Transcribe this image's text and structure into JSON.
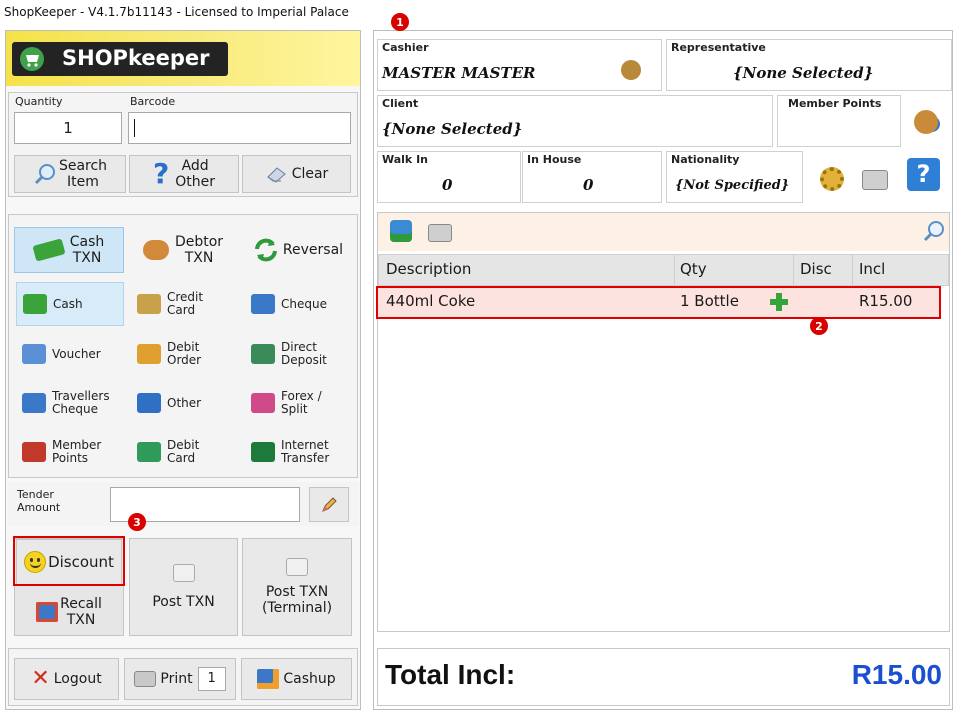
{
  "window": {
    "title": "ShopKeeper - V4.1.7b11143 - Licensed to Imperial Palace"
  },
  "logo": {
    "text": "SHOPkeeper"
  },
  "entry": {
    "quantity_label": "Quantity",
    "quantity_value": "1",
    "barcode_label": "Barcode",
    "barcode_value": ""
  },
  "actions": {
    "search": [
      "Search",
      "Item"
    ],
    "add": [
      "Add",
      "Other"
    ],
    "clear": "Clear"
  },
  "txn_types": {
    "cash": [
      "Cash",
      "TXN"
    ],
    "debtor": [
      "Debtor",
      "TXN"
    ],
    "reversal": "Reversal"
  },
  "payment_methods": [
    {
      "label": "Cash",
      "icon": "cash-icon",
      "color": "#3aa43a"
    },
    {
      "label": "Credit\nCard",
      "icon": "credit-card-icon",
      "color": "#c8a24a"
    },
    {
      "label": "Cheque",
      "icon": "cheque-icon",
      "color": "#3b78c8"
    },
    {
      "label": "Voucher",
      "icon": "voucher-icon",
      "color": "#5b8fd6"
    },
    {
      "label": "Debit\nOrder",
      "icon": "debit-order-icon",
      "color": "#e0a030"
    },
    {
      "label": "Direct\nDeposit",
      "icon": "direct-deposit-icon",
      "color": "#3a8a5a"
    },
    {
      "label": "Travellers\nCheque",
      "icon": "travellers-cheque-icon",
      "color": "#3b78c8"
    },
    {
      "label": "Other",
      "icon": "other-help-icon",
      "color": "#2f6fc4"
    },
    {
      "label": "Forex /\nSplit",
      "icon": "forex-icon",
      "color": "#d04a8a"
    },
    {
      "label": "Member\nPoints",
      "icon": "member-points-icon",
      "color": "#c0392b"
    },
    {
      "label": "Debit\nCard",
      "icon": "debit-card-icon",
      "color": "#2f9a5a"
    },
    {
      "label": "Internet\nTransfer",
      "icon": "globe-icon",
      "color": "#1e7a3a"
    }
  ],
  "tender": {
    "label": "Tender\nAmount",
    "value": ""
  },
  "bottom_actions": {
    "discount": "Discount",
    "recall": [
      "Recall",
      "TXN"
    ],
    "post": "Post TXN",
    "post_terminal": [
      "Post TXN",
      "(Terminal)"
    ]
  },
  "footer": {
    "logout": "Logout",
    "print": "Print",
    "print_copies": "1",
    "cashup": "Cashup"
  },
  "header": {
    "cashier_label": "Cashier",
    "cashier_value": "MASTER MASTER",
    "representative_label": "Representative",
    "representative_value": "{None Selected}",
    "client_label": "Client",
    "client_value": "{None Selected}",
    "member_points_label": "Member Points",
    "member_points_value": "",
    "walkin_label": "Walk In",
    "walkin_value": "0",
    "inhouse_label": "In House",
    "inhouse_value": "0",
    "nationality_label": "Nationality",
    "nationality_value": "{Not Specified}"
  },
  "grid": {
    "columns": [
      "Description",
      "Qty",
      "Disc",
      "Incl"
    ],
    "rows": [
      {
        "description": "440ml Coke",
        "qty": "1 Bottle",
        "disc": "",
        "incl": "R15.00"
      }
    ]
  },
  "total": {
    "label": "Total Incl:",
    "value": "R15.00"
  },
  "annotations": [
    "1",
    "2",
    "3"
  ],
  "colors": {
    "total_value": "#1a4fd0",
    "highlight_row": "#fde3df",
    "annotation": "#d90000"
  }
}
